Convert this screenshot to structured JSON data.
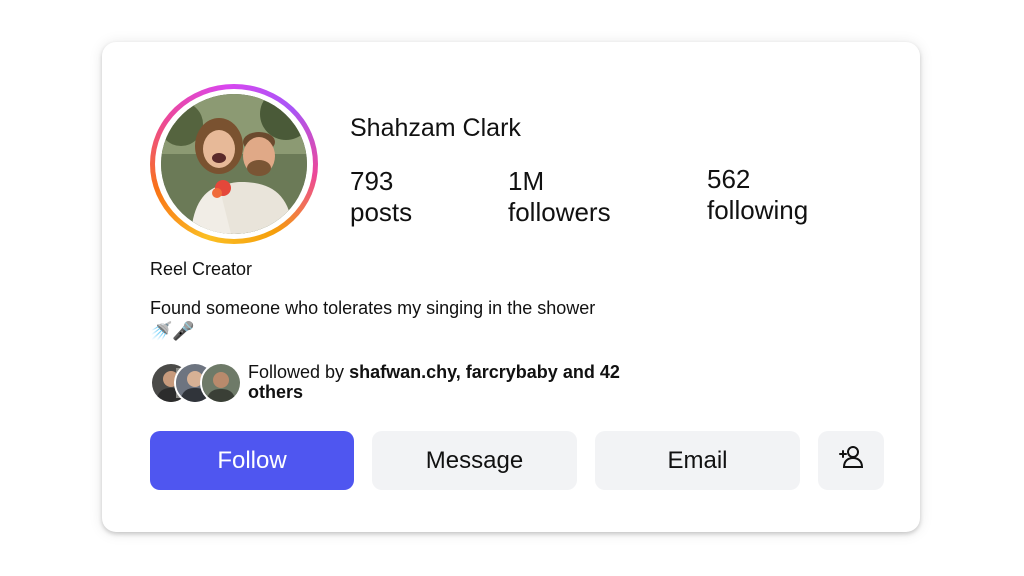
{
  "profile": {
    "username": "Shahzam Clark",
    "role": "Reel Creator",
    "bio": "Found someone who tolerates my singing in the shower 🚿🎤"
  },
  "stats": {
    "posts": {
      "count": "793",
      "label": "posts"
    },
    "followers": {
      "count": "1M",
      "label": "followers"
    },
    "following": {
      "count": "562",
      "label": "following"
    }
  },
  "mutuals": {
    "prefix": "Followed by ",
    "names": "shafwan.chy, farcrybaby",
    "and": " and ",
    "others": "42 others"
  },
  "actions": {
    "follow_label": "Follow",
    "message_label": "Message",
    "email_label": "Email",
    "add_friend_icon": "person-add-icon"
  },
  "colors": {
    "accent": "#4f56f0",
    "secondary_button": "#f2f3f5",
    "story_ring": [
      "#fbbf24",
      "#f97316",
      "#ec4899",
      "#d946ef"
    ]
  }
}
